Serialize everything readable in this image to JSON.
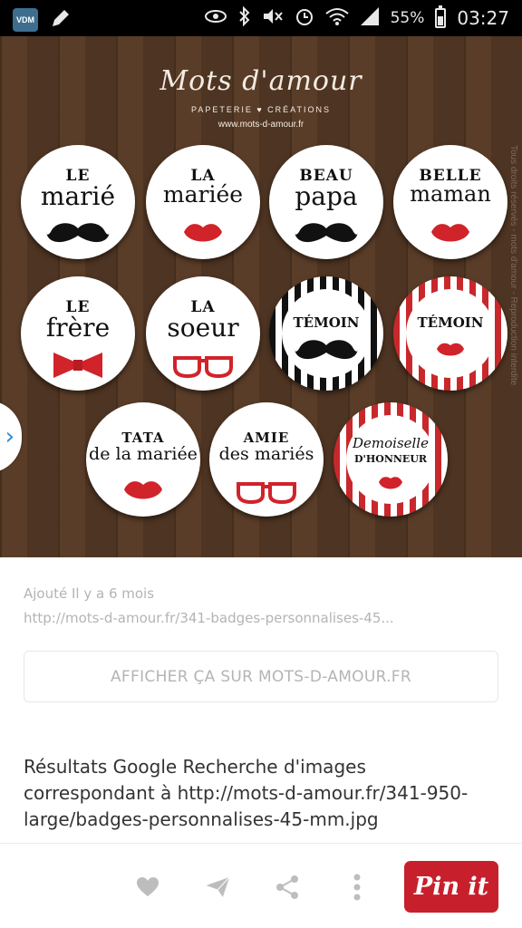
{
  "status_bar": {
    "app_badge": "VDM",
    "icons": [
      "vdm-app-icon",
      "pencil-icon",
      "eye-icon",
      "bluetooth-icon",
      "mute-icon",
      "alarm-icon",
      "wifi-icon",
      "signal-icon",
      "battery-icon"
    ],
    "battery_percent": "55%",
    "battery_level": 0.55,
    "time": "03:27"
  },
  "pin_image": {
    "brand_title": "Mots d'amour",
    "brand_subtitle": "PAPETERIE ♥ CRÉATIONS",
    "brand_url": "www.mots-d-amour.fr",
    "watermark": "Tous droits réservés - mots d'amour - Reproduction interdite",
    "badges": [
      {
        "line1": "LE",
        "line2": "marié",
        "motif": "mustache"
      },
      {
        "line1": "LA",
        "line2": "mariée",
        "motif": "lips"
      },
      {
        "line1": "BEAU",
        "line2": "papa",
        "motif": "mustache"
      },
      {
        "line1": "BELLE",
        "line2": "maman",
        "motif": "lips"
      },
      {
        "line1": "LE",
        "line2": "frère",
        "motif": "bowtie"
      },
      {
        "line1": "LA",
        "line2": "soeur",
        "motif": "glasses"
      },
      {
        "line1": "TÉMOIN",
        "line2": "",
        "motif": "mustache"
      },
      {
        "line1": "TÉMOIN",
        "line2": "",
        "motif": "lips"
      },
      {
        "line1": "TATA",
        "line2": "de la mariée",
        "motif": "lips"
      },
      {
        "line1": "AMIE",
        "line2": "des mariés",
        "motif": "glasses"
      },
      {
        "line1": "Demoiselle",
        "line2": "D'HONNEUR",
        "motif": "lips"
      }
    ]
  },
  "details": {
    "added": "Ajouté Il y a 6 mois",
    "source_url": "http://mots-d-amour.fr/341-badges-personnalises-45...",
    "visit_label": "AFFICHER ÇA SUR MOTS-D-AMOUR.FR",
    "description": "Résultats Google Recherche d'images correspondant à http://mots-d-amour.fr/341-950-large/badges-personnalises-45-mm.jpg"
  },
  "bottom_bar": {
    "icons": [
      "heart-icon",
      "send-icon",
      "share-icon",
      "more-icon"
    ],
    "pin_label": "Pin it"
  },
  "colors": {
    "accent_red": "#c7202c",
    "link_blue": "#2a8bd0",
    "wood": "#553a26"
  }
}
